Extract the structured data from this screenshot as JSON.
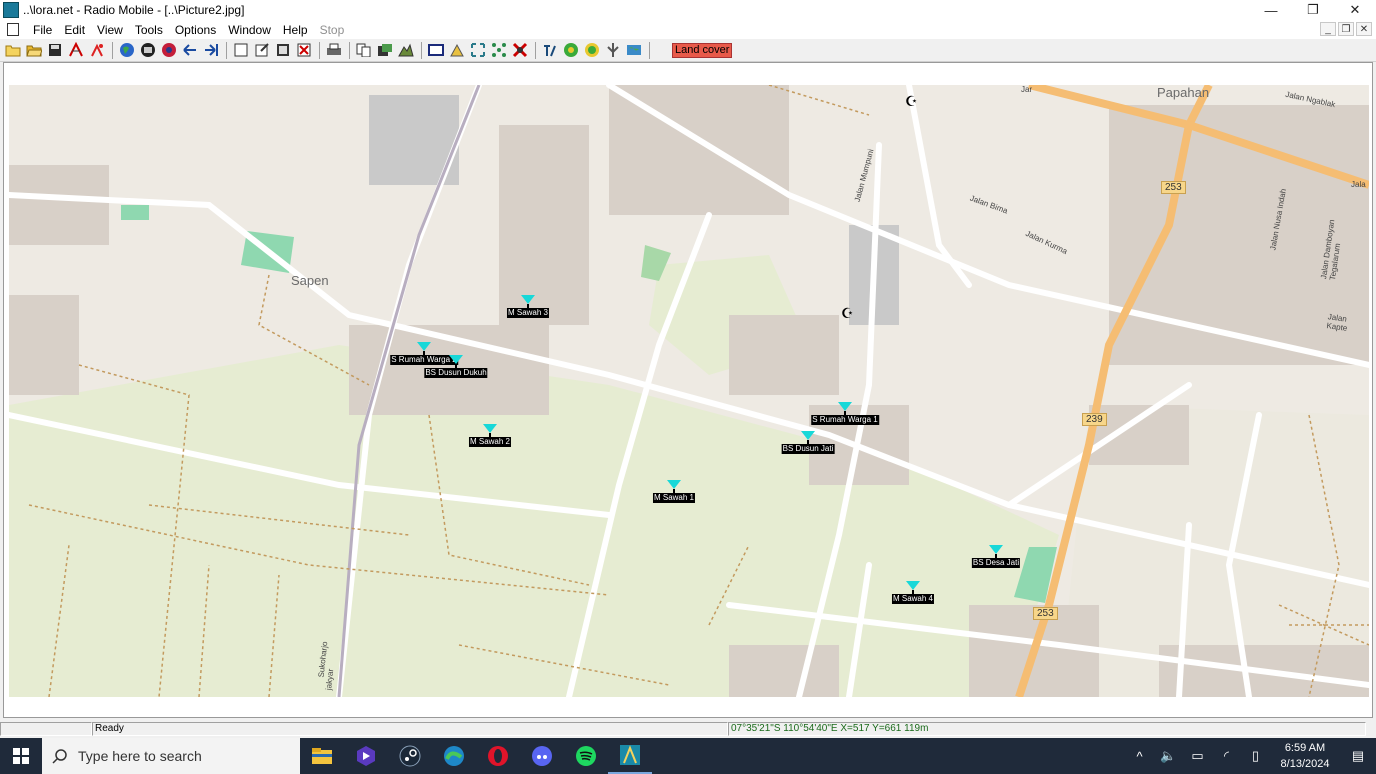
{
  "window": {
    "title": "..\\lora.net - Radio Mobile - [..\\Picture2.jpg]",
    "minimize_glyph": "—",
    "maximize_glyph": "❐",
    "close_glyph": "✕"
  },
  "menu": {
    "items": [
      "File",
      "Edit",
      "View",
      "Tools",
      "Options",
      "Window",
      "Help",
      "Stop"
    ]
  },
  "toolbar": {
    "land_cover_label": "Land cover"
  },
  "map": {
    "place_labels": {
      "sapen": "Sapen",
      "papahan": "Papahan",
      "jalan_ngablak": "Jalan Ngablak",
      "jalan_bima": "Jalan Bima",
      "jalan_kurma": "Jalan Kurma",
      "jalan_mumpuni": "Jalan Mumpuni",
      "jalan_kapte": "Jalan Kapte",
      "sukoharjo": "Sukoharjo",
      "jalan_nusa_indah": "Jalan Nusa Indah",
      "jalan_damboyan": "Jalan Damboyan Tegalarum",
      "jala": "Jala",
      "jar": "Jar",
      "jakyar": "jakyar"
    },
    "road_numbers": {
      "r253_top": "253",
      "r239": "239",
      "r253_bottom": "253"
    },
    "markers": [
      {
        "label": "M Sawah 3"
      },
      {
        "label": "S Rumah Warga 2"
      },
      {
        "label": "BS Dusun Dukuh"
      },
      {
        "label": "M Sawah 2"
      },
      {
        "label": "S Rumah Warga 1"
      },
      {
        "label": "BS Dusun Jati"
      },
      {
        "label": "M Sawah 1"
      },
      {
        "label": "BS Desa Jati"
      },
      {
        "label": "M Sawah 4"
      }
    ]
  },
  "status": {
    "left": "",
    "ready": "Ready",
    "coords": "07°35'21\"S 110°54'40\"E  X=517 Y=661 119m"
  },
  "taskbar": {
    "search_placeholder": "Type here to search",
    "time": "6:59 AM",
    "date": "8/13/2024"
  }
}
